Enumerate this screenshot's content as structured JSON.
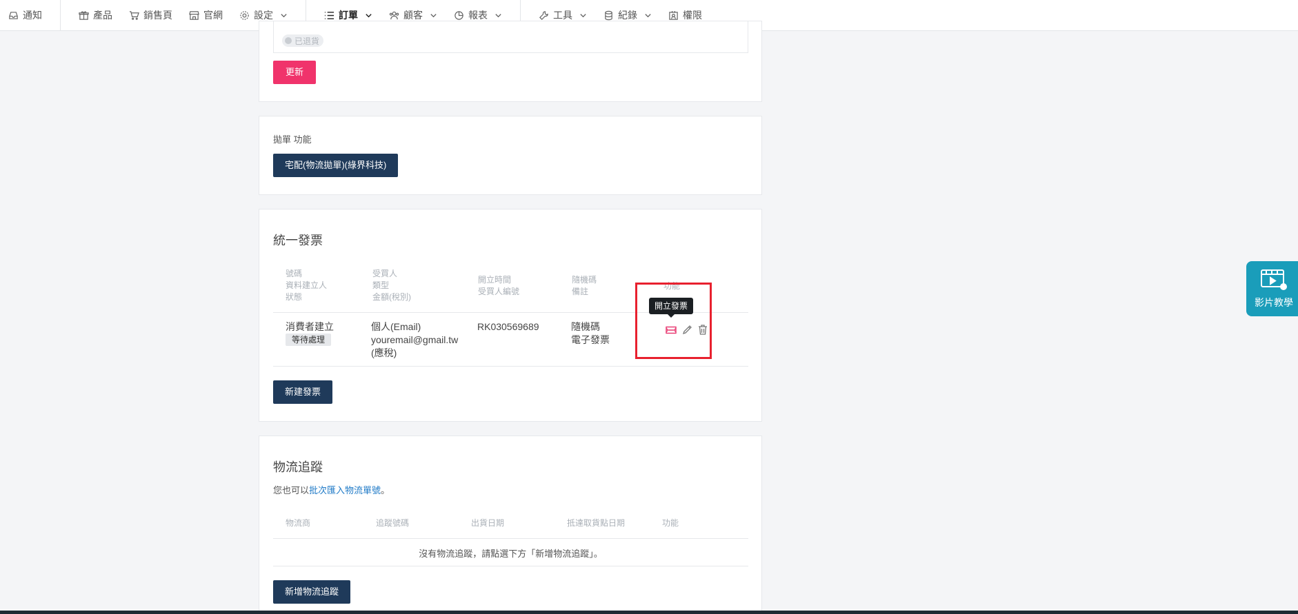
{
  "nav": {
    "notify": "通知",
    "products": "產品",
    "sales_page": "銷售頁",
    "store": "官網",
    "settings": "設定",
    "orders": "訂單",
    "customers": "顧客",
    "reports": "報表",
    "tools": "工具",
    "logs": "紀錄",
    "permissions": "權限"
  },
  "status_card": {
    "returned_chip": "已退貨",
    "update_button": "更新"
  },
  "waybill_card": {
    "label": "拋單 功能",
    "button": "宅配(物流拋單)(綠界科技)"
  },
  "invoice_card": {
    "title": "統一發票",
    "headers": [
      [
        "號碼",
        "資料建立人",
        "狀態"
      ],
      [
        "受買人",
        "類型",
        "金額(稅別)"
      ],
      [
        "開立時間",
        "受買人編號"
      ],
      [
        "隨機碼",
        "備註"
      ],
      [
        "功能"
      ]
    ],
    "row": {
      "creator": "消費者建立",
      "status": "等待處理",
      "buyer": "個人(Email)",
      "email": "youremail@gmail.tw",
      "tax": "(應稅)",
      "buyer_no": "RK030569689",
      "random_code": "隨機碼",
      "note": "電子發票"
    },
    "tooltip": "開立發票",
    "new_button": "新建發票"
  },
  "logistics_card": {
    "title": "物流追蹤",
    "hint_prefix": "您也可以",
    "hint_link": "批次匯入物流單號",
    "hint_suffix": "。",
    "headers": [
      "物流商",
      "追蹤號碼",
      "出貨日期",
      "抵達取貨點日期",
      "功能"
    ],
    "empty": "沒有物流追蹤，請點選下方「新增物流追蹤」。",
    "new_button": "新增物流追蹤"
  },
  "float": {
    "video_label": "影片教學"
  },
  "colors": {
    "accent": "#e8336d",
    "dark_button": "#1f3a5a",
    "highlight": "#e8202e",
    "invoice_icon": "#e8336d",
    "float_bg": "#1a9dba"
  }
}
